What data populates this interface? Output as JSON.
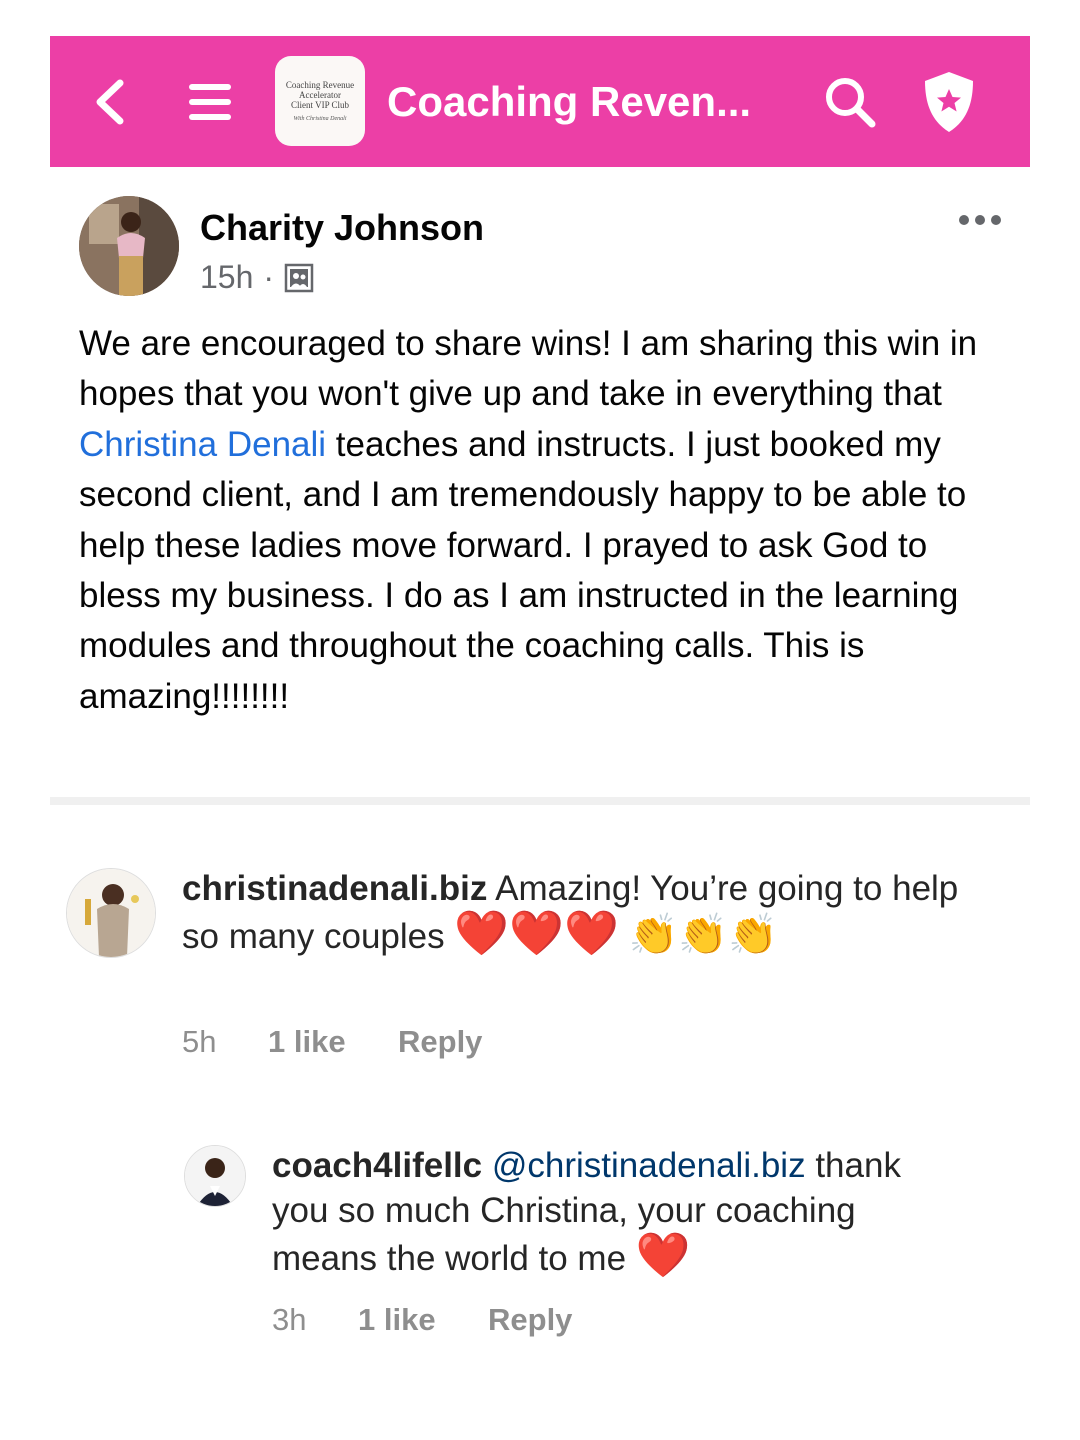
{
  "header": {
    "group_title": "Coaching Reven...",
    "logo_line1": "Coaching Revenue",
    "logo_line2": "Accelerator",
    "logo_line3": "Client VIP Club",
    "logo_line4": "With Christina Denali",
    "accent_color": "#ec3fa6",
    "icons": [
      "chevron-left-icon",
      "menu-icon",
      "search-icon",
      "shield-star-icon"
    ]
  },
  "post": {
    "author": "Charity Johnson",
    "time": "15h",
    "separator": "·",
    "audience_icon": "group-photo-icon",
    "body_part1": "We are encouraged to share wins! I am sharing this win in hopes that you won't give up and take in everything that ",
    "mention": "Christina Denali",
    "body_part2": " teaches and instructs. I just booked my second client, and I am tremendously happy to be able to help these ladies move forward.  I prayed to ask God to bless my business. I do as I am instructed in the learning modules and throughout the coaching calls. This is amazing!!!!!!!!",
    "more_icon": "more-horizontal-icon"
  },
  "comments": [
    {
      "username": "christinadenali.biz",
      "text": " Amazing! You’re going to help so many couples ",
      "emojis_hearts": "❤️❤️❤️",
      "emojis_claps": "👏👏👏",
      "time": "5h",
      "likes": "1 like",
      "reply": "Reply"
    },
    {
      "username": "coach4lifellc",
      "mention": "@christinadenali.biz",
      "text": " thank you so much Christina, your coaching means the world to me ",
      "emojis_hearts": "❤️",
      "time": "3h",
      "likes": "1 like",
      "reply": "Reply"
    }
  ]
}
